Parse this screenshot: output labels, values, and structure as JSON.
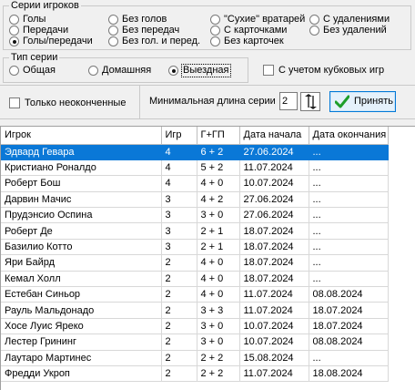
{
  "groups": {
    "players_series": {
      "legend": "Серии игроков",
      "options": [
        {
          "label": "Голы",
          "selected": false
        },
        {
          "label": "Передачи",
          "selected": false
        },
        {
          "label": "Голы/передачи",
          "selected": true
        },
        {
          "label": "Без голов",
          "selected": false
        },
        {
          "label": "Без передач",
          "selected": false
        },
        {
          "label": "Без гол. и перед.",
          "selected": false
        },
        {
          "label": "\"Сухие\" вратарей",
          "selected": false
        },
        {
          "label": "С карточками",
          "selected": false
        },
        {
          "label": "Без карточек",
          "selected": false
        },
        {
          "label": "С удалениями",
          "selected": false
        },
        {
          "label": "Без удалений",
          "selected": false
        }
      ]
    },
    "series_type": {
      "legend": "Тип серии",
      "options": [
        {
          "label": "Общая",
          "selected": false
        },
        {
          "label": "Домашняя",
          "selected": false
        },
        {
          "label": "Выездная",
          "selected": true
        }
      ]
    }
  },
  "cup_games_checkbox": {
    "label": "С учетом кубковых игр",
    "checked": false
  },
  "unfinished_checkbox": {
    "label": "Только неоконченные",
    "checked": false
  },
  "min_length": {
    "label": "Минимальная длина серии",
    "value": "2"
  },
  "accept_button": {
    "label": "Принять"
  },
  "table": {
    "columns": [
      "Игрок",
      "Игр",
      "Г+ГП",
      "Дата начала",
      "Дата окончания"
    ],
    "selected_row": 0,
    "rows": [
      [
        "Эдвард Гевара",
        "4",
        "6 + 2",
        "27.06.2024",
        "..."
      ],
      [
        "Кристиано Роналдо",
        "4",
        "5 + 2",
        "11.07.2024",
        "..."
      ],
      [
        "Роберт Бош",
        "4",
        "4 + 0",
        "10.07.2024",
        "..."
      ],
      [
        "Дарвин Мачис",
        "3",
        "4 + 2",
        "27.06.2024",
        "..."
      ],
      [
        "Прудэнсио Оспина",
        "3",
        "3 + 0",
        "27.06.2024",
        "..."
      ],
      [
        "Роберт Де",
        "3",
        "2 + 1",
        "18.07.2024",
        "..."
      ],
      [
        "Базилио Котто",
        "3",
        "2 + 1",
        "18.07.2024",
        "..."
      ],
      [
        "Яри Байрд",
        "2",
        "4 + 0",
        "18.07.2024",
        "..."
      ],
      [
        "Кемал Холл",
        "2",
        "4 + 0",
        "18.07.2024",
        "..."
      ],
      [
        "Естебан Синьор",
        "2",
        "4 + 0",
        "11.07.2024",
        "08.08.2024"
      ],
      [
        "Рауль Мальдонадо",
        "2",
        "3 + 3",
        "11.07.2024",
        "18.07.2024"
      ],
      [
        "Хосе Луис Яреко",
        "2",
        "3 + 0",
        "10.07.2024",
        "18.07.2024"
      ],
      [
        "Лестер Грининг",
        "2",
        "3 + 0",
        "10.07.2024",
        "08.08.2024"
      ],
      [
        "Лаутаро Мартинес",
        "2",
        "2 + 2",
        "15.08.2024",
        "..."
      ],
      [
        "Фредди Укроп",
        "2",
        "2 + 2",
        "11.07.2024",
        "18.08.2024"
      ]
    ]
  },
  "colors": {
    "selection": "#0a78d7",
    "accept_check": "#1e9e2a"
  }
}
